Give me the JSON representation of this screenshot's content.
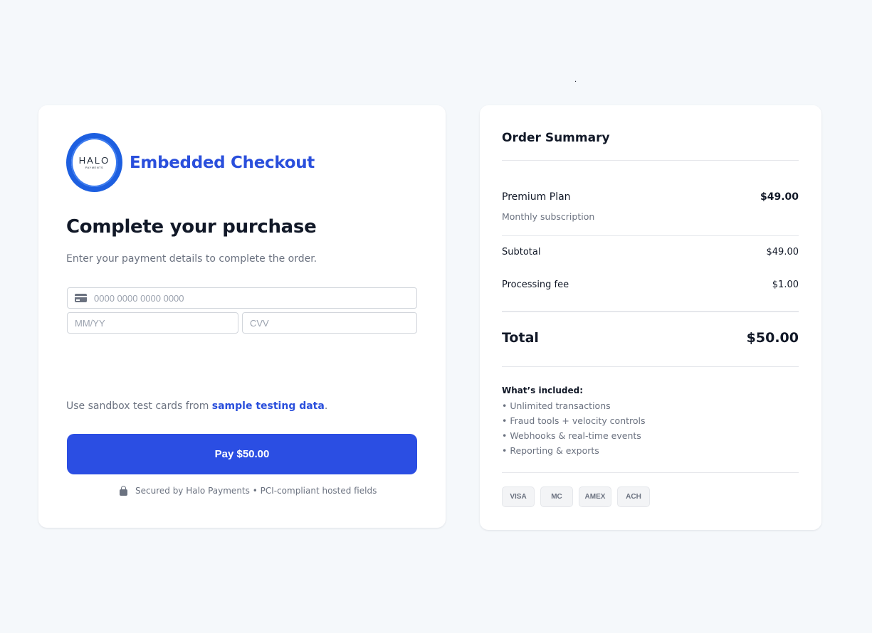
{
  "page": {
    "dot": "."
  },
  "checkout": {
    "logo": {
      "main": "HALO",
      "sub": "PAYMENTS"
    },
    "brand_title": "Embedded Checkout",
    "heading": "Complete your purchase",
    "subtext": "Enter your payment details to complete the order.",
    "card_number": {
      "placeholder": "0000 0000 0000 0000",
      "value": ""
    },
    "expiry": {
      "placeholder": "MM/YY",
      "value": ""
    },
    "cvv": {
      "placeholder": "CVV",
      "value": ""
    },
    "sandbox_prefix": "Use sandbox test cards from ",
    "sandbox_link": "sample testing data",
    "sandbox_suffix": ".",
    "pay_button": "Pay $50.00",
    "secure_note": "Secured by Halo Payments • PCI-compliant hosted fields"
  },
  "summary": {
    "title": "Order Summary",
    "item": {
      "name": "Premium Plan",
      "price": "$49.00",
      "description": "Monthly subscription"
    },
    "subtotal": {
      "label": "Subtotal",
      "value": "$49.00"
    },
    "fee": {
      "label": "Processing fee",
      "value": "$1.00"
    },
    "total": {
      "label": "Total",
      "value": "$50.00"
    },
    "included_title": "What’s included:",
    "included": [
      "• Unlimited transactions",
      "• Fraud tools + velocity controls",
      "• Webhooks & real-time events",
      "• Reporting & exports"
    ],
    "payment_methods": [
      "VISA",
      "MC",
      "AMEX",
      "ACH"
    ]
  },
  "colors": {
    "accent": "#2b4ee3",
    "brand": "#2a4fdc",
    "background": "#f5f8fb"
  }
}
